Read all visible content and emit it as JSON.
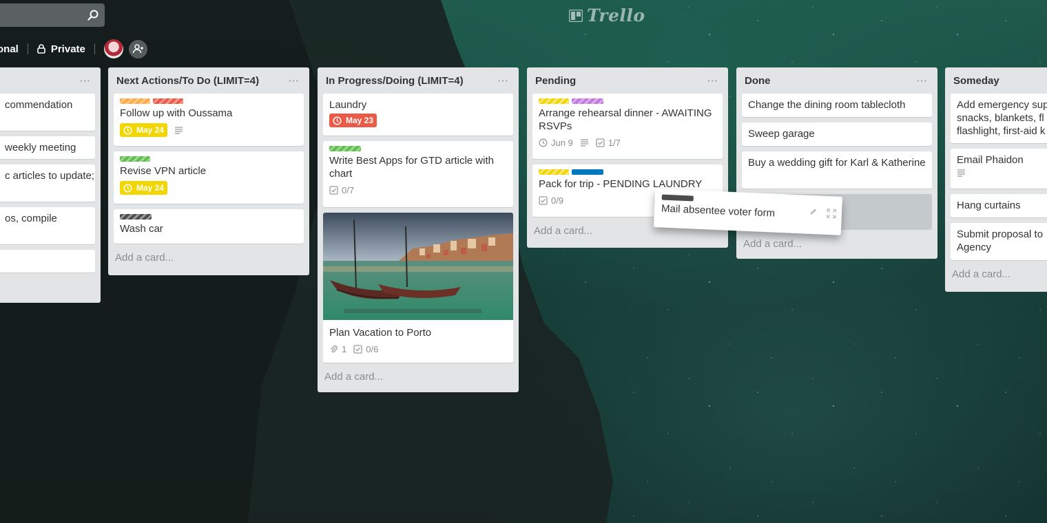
{
  "logo": {
    "text": "Trello"
  },
  "board": {
    "team": "onal",
    "visibility": "Private"
  },
  "lists": {
    "list0": {
      "cards": [
        "commendation",
        "weekly meeting",
        "c articles to update;",
        "os, compile",
        ""
      ]
    },
    "next": {
      "title": "Next Actions/To Do (LIMIT=4)",
      "cards": {
        "c1": {
          "title": "Follow up with Oussama",
          "due": "May 24"
        },
        "c2": {
          "title": "Revise VPN article",
          "due": "May 24"
        },
        "c3": {
          "title": "Wash car"
        }
      },
      "add": "Add a card..."
    },
    "progress": {
      "title": "In Progress/Doing (LIMIT=4)",
      "cards": {
        "c1": {
          "title": "Laundry",
          "due": "May 23"
        },
        "c2": {
          "title": "Write Best Apps for GTD article with chart",
          "checklist": "0/7"
        },
        "c3": {
          "title": "Plan Vacation to Porto",
          "attachments": "1",
          "checklist": "0/6"
        }
      },
      "add": "Add a card..."
    },
    "pending": {
      "title": "Pending",
      "cards": {
        "c1": {
          "title": "Arrange rehearsal dinner - AWAITING RSVPs",
          "due": "Jun 9",
          "checklist": "1/7"
        },
        "c2": {
          "title": "Pack for trip - PENDING LAUNDRY",
          "checklist": "0/9"
        }
      },
      "add": "Add a card..."
    },
    "done": {
      "title": "Done",
      "cards": {
        "c1": {
          "title": "Change the dining room tablecloth"
        },
        "c2": {
          "title": "Sweep garage"
        },
        "c3": {
          "title": "Buy a wedding gift for Karl & Katherine"
        }
      },
      "add": "Add a card..."
    },
    "someday": {
      "title": "Someday",
      "cards": {
        "c1": {
          "title": "Add emergency sup snacks, blankets, fl flashlight, first-aid k"
        },
        "c2": {
          "title": "Email Phaidon"
        },
        "c3": {
          "title": "Hang curtains"
        },
        "c4": {
          "title": "Submit proposal to Agency"
        }
      },
      "add": "Add a card..."
    }
  },
  "dragging": {
    "title": "Mail absentee voter form"
  },
  "colors": {
    "label_orange": "#ffab4a",
    "label_red": "#eb5a46",
    "label_green": "#61bd4f",
    "label_black": "#4d4d4d",
    "label_yellow": "#f2d600",
    "label_purple": "#c377e0",
    "label_blue": "#0079bf",
    "due_yellow": "#f2d600",
    "due_red": "#eb5a46"
  }
}
